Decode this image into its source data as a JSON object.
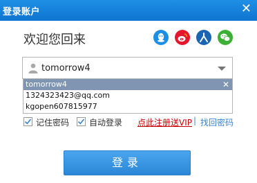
{
  "window": {
    "title": "登录账户",
    "close_glyph": "✕"
  },
  "welcome_text": "欢迎您回来",
  "social_icons": [
    "qq-icon",
    "weibo-icon",
    "renren-icon",
    "wechat-icon"
  ],
  "account": {
    "value": "tomorrow4"
  },
  "dropdown": {
    "items": [
      {
        "label": "tomorrow4",
        "selected": true
      },
      {
        "label": "1324323423@qq.com",
        "selected": false
      },
      {
        "label": "kgopen607815977",
        "selected": false
      }
    ],
    "remove_glyph": "✕"
  },
  "options": {
    "remember_label": "记住密码",
    "remember_checked": true,
    "autologin_label": "自动登录",
    "autologin_checked": true
  },
  "links": {
    "register": "点此注册送VIP",
    "separator": "|",
    "recover": "找回密码"
  },
  "login_button_label": "登录",
  "colors": {
    "titlebar": "#1677d2",
    "qq": "#1b8fe6",
    "weibo": "#e6162d",
    "renren": "#1a64b4",
    "wechat": "#3cb034",
    "register": "#cc0000",
    "link": "#3a83d0"
  }
}
